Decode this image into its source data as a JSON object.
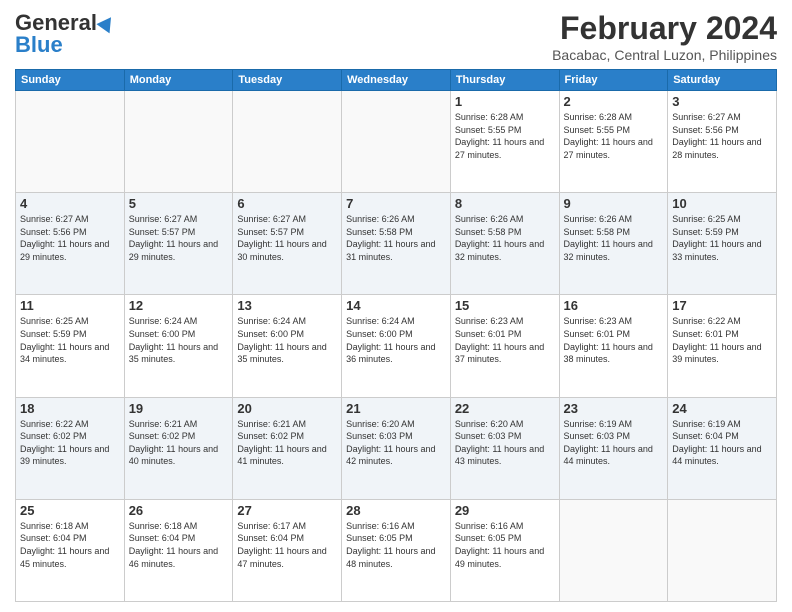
{
  "header": {
    "logo_line1": "General",
    "logo_line2": "Blue",
    "title": "February 2024",
    "subtitle": "Bacabac, Central Luzon, Philippines"
  },
  "days_of_week": [
    "Sunday",
    "Monday",
    "Tuesday",
    "Wednesday",
    "Thursday",
    "Friday",
    "Saturday"
  ],
  "weeks": [
    [
      {
        "day": "",
        "info": ""
      },
      {
        "day": "",
        "info": ""
      },
      {
        "day": "",
        "info": ""
      },
      {
        "day": "",
        "info": ""
      },
      {
        "day": "1",
        "info": "Sunrise: 6:28 AM\nSunset: 5:55 PM\nDaylight: 11 hours and 27 minutes."
      },
      {
        "day": "2",
        "info": "Sunrise: 6:28 AM\nSunset: 5:55 PM\nDaylight: 11 hours and 27 minutes."
      },
      {
        "day": "3",
        "info": "Sunrise: 6:27 AM\nSunset: 5:56 PM\nDaylight: 11 hours and 28 minutes."
      }
    ],
    [
      {
        "day": "4",
        "info": "Sunrise: 6:27 AM\nSunset: 5:56 PM\nDaylight: 11 hours and 29 minutes."
      },
      {
        "day": "5",
        "info": "Sunrise: 6:27 AM\nSunset: 5:57 PM\nDaylight: 11 hours and 29 minutes."
      },
      {
        "day": "6",
        "info": "Sunrise: 6:27 AM\nSunset: 5:57 PM\nDaylight: 11 hours and 30 minutes."
      },
      {
        "day": "7",
        "info": "Sunrise: 6:26 AM\nSunset: 5:58 PM\nDaylight: 11 hours and 31 minutes."
      },
      {
        "day": "8",
        "info": "Sunrise: 6:26 AM\nSunset: 5:58 PM\nDaylight: 11 hours and 32 minutes."
      },
      {
        "day": "9",
        "info": "Sunrise: 6:26 AM\nSunset: 5:58 PM\nDaylight: 11 hours and 32 minutes."
      },
      {
        "day": "10",
        "info": "Sunrise: 6:25 AM\nSunset: 5:59 PM\nDaylight: 11 hours and 33 minutes."
      }
    ],
    [
      {
        "day": "11",
        "info": "Sunrise: 6:25 AM\nSunset: 5:59 PM\nDaylight: 11 hours and 34 minutes."
      },
      {
        "day": "12",
        "info": "Sunrise: 6:24 AM\nSunset: 6:00 PM\nDaylight: 11 hours and 35 minutes."
      },
      {
        "day": "13",
        "info": "Sunrise: 6:24 AM\nSunset: 6:00 PM\nDaylight: 11 hours and 35 minutes."
      },
      {
        "day": "14",
        "info": "Sunrise: 6:24 AM\nSunset: 6:00 PM\nDaylight: 11 hours and 36 minutes."
      },
      {
        "day": "15",
        "info": "Sunrise: 6:23 AM\nSunset: 6:01 PM\nDaylight: 11 hours and 37 minutes."
      },
      {
        "day": "16",
        "info": "Sunrise: 6:23 AM\nSunset: 6:01 PM\nDaylight: 11 hours and 38 minutes."
      },
      {
        "day": "17",
        "info": "Sunrise: 6:22 AM\nSunset: 6:01 PM\nDaylight: 11 hours and 39 minutes."
      }
    ],
    [
      {
        "day": "18",
        "info": "Sunrise: 6:22 AM\nSunset: 6:02 PM\nDaylight: 11 hours and 39 minutes."
      },
      {
        "day": "19",
        "info": "Sunrise: 6:21 AM\nSunset: 6:02 PM\nDaylight: 11 hours and 40 minutes."
      },
      {
        "day": "20",
        "info": "Sunrise: 6:21 AM\nSunset: 6:02 PM\nDaylight: 11 hours and 41 minutes."
      },
      {
        "day": "21",
        "info": "Sunrise: 6:20 AM\nSunset: 6:03 PM\nDaylight: 11 hours and 42 minutes."
      },
      {
        "day": "22",
        "info": "Sunrise: 6:20 AM\nSunset: 6:03 PM\nDaylight: 11 hours and 43 minutes."
      },
      {
        "day": "23",
        "info": "Sunrise: 6:19 AM\nSunset: 6:03 PM\nDaylight: 11 hours and 44 minutes."
      },
      {
        "day": "24",
        "info": "Sunrise: 6:19 AM\nSunset: 6:04 PM\nDaylight: 11 hours and 44 minutes."
      }
    ],
    [
      {
        "day": "25",
        "info": "Sunrise: 6:18 AM\nSunset: 6:04 PM\nDaylight: 11 hours and 45 minutes."
      },
      {
        "day": "26",
        "info": "Sunrise: 6:18 AM\nSunset: 6:04 PM\nDaylight: 11 hours and 46 minutes."
      },
      {
        "day": "27",
        "info": "Sunrise: 6:17 AM\nSunset: 6:04 PM\nDaylight: 11 hours and 47 minutes."
      },
      {
        "day": "28",
        "info": "Sunrise: 6:16 AM\nSunset: 6:05 PM\nDaylight: 11 hours and 48 minutes."
      },
      {
        "day": "29",
        "info": "Sunrise: 6:16 AM\nSunset: 6:05 PM\nDaylight: 11 hours and 49 minutes."
      },
      {
        "day": "",
        "info": ""
      },
      {
        "day": "",
        "info": ""
      }
    ]
  ],
  "colors": {
    "header_bg": "#2a7fc9",
    "alt_row": "#f0f4f8",
    "empty_cell": "#f9f9f9"
  }
}
